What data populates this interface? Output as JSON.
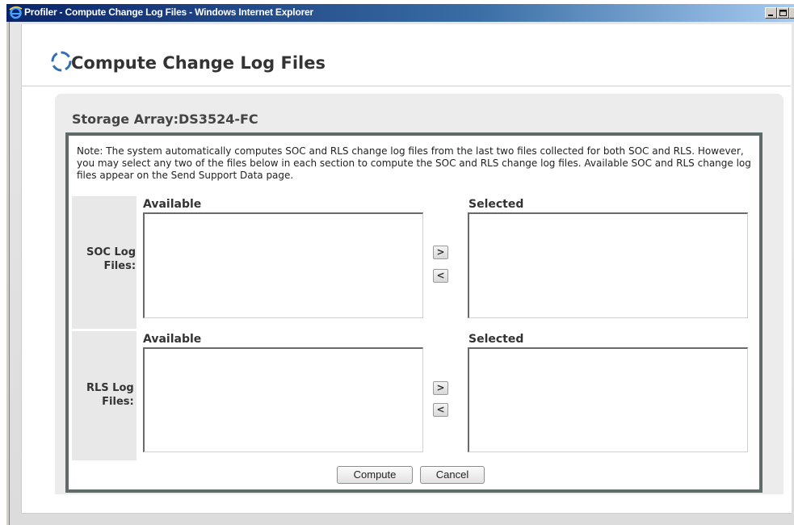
{
  "window": {
    "title": "Profiler - Compute Change Log Files - Windows Internet Explorer"
  },
  "page": {
    "title": "Compute Change Log Files",
    "storage_array_label": "Storage Array:DS3524-FC",
    "note": "Note: The system automatically computes SOC and RLS change log files from the last two files collected for both SOC and RLS. However, you may select any two of the files below in each section to compute the SOC and RLS change log files. Available SOC and RLS change log files appear on the Send Support Data page."
  },
  "soc": {
    "label_line1": "SOC Log",
    "label_line2": "Files:",
    "available_header": "Available",
    "selected_header": "Selected",
    "add_arrow": ">",
    "remove_arrow": "<"
  },
  "rls": {
    "label_line1": "RLS Log",
    "label_line2": "Files:",
    "available_header": "Available",
    "selected_header": "Selected",
    "add_arrow": ">",
    "remove_arrow": "<"
  },
  "actions": {
    "compute": "Compute",
    "cancel": "Cancel"
  },
  "icons": {
    "browser": "ie-icon",
    "loading": "spinner-icon"
  }
}
